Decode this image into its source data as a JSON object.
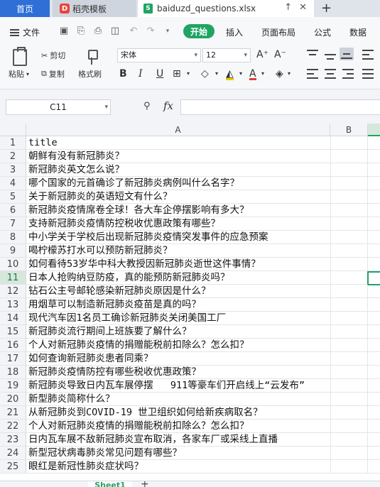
{
  "tabs": {
    "home": "首页",
    "template": "稻壳模板",
    "template_logo": "D",
    "file": "baiduzd_questions.xlsx",
    "file_logo": "S",
    "add": "+"
  },
  "menu": {
    "file": "文件",
    "start": "开始",
    "insert": "插入",
    "page_layout": "页面布局",
    "formula": "公式",
    "data": "数据"
  },
  "toolbar": {
    "paste": "粘贴",
    "cut": "剪切",
    "copy": "复制",
    "format_painter": "格式刷",
    "font_name": "宋体",
    "font_size": "12",
    "bold": "B",
    "italic": "I",
    "underline": "U",
    "grow": "A⁺",
    "shrink": "A⁻"
  },
  "formula_bar": {
    "name_box": "C11",
    "fx": "fx",
    "value": ""
  },
  "grid": {
    "columns": [
      "A",
      "B"
    ],
    "active_column": "C",
    "active_row": 11,
    "rows": [
      {
        "n": "1",
        "a": "title"
      },
      {
        "n": "2",
        "a": "朝鲜有没有新冠肺炎？"
      },
      {
        "n": "3",
        "a": "新冠肺炎英文怎么说？"
      },
      {
        "n": "4",
        "a": "哪个国家的元首确诊了新冠肺炎病例叫什么名字？"
      },
      {
        "n": "5",
        "a": "关于新冠肺炎的英语短文有什么？"
      },
      {
        "n": "6",
        "a": "新冠肺炎疫情席卷全球！各大车企停摆影响有多大？"
      },
      {
        "n": "7",
        "a": "支持新冠肺炎疫情防控税收优惠政策有哪些？"
      },
      {
        "n": "8",
        "a": "中小学关于学校后出现新冠肺炎疫情突发事件的应急预案"
      },
      {
        "n": "9",
        "a": "喝柠檬苏打水可以预防新冠肺炎？"
      },
      {
        "n": "10",
        "a": "如何看待53岁华中科大教授因新冠肺炎逝世这件事情？"
      },
      {
        "n": "11",
        "a": "日本人抢购纳豆防疫，真的能预防新冠肺炎吗？"
      },
      {
        "n": "12",
        "a": "钻石公主号邮轮感染新冠肺炎原因是什么？"
      },
      {
        "n": "13",
        "a": "用烟草可以制造新冠肺炎疫苗是真的吗？"
      },
      {
        "n": "14",
        "a": "现代汽车因1名员工确诊新冠肺炎关闭美国工厂"
      },
      {
        "n": "15",
        "a": "新冠肺炎流行期间上班族要了解什么？"
      },
      {
        "n": "16",
        "a": "个人对新冠肺炎疫情的捐赠能税前扣除么？怎么扣？"
      },
      {
        "n": "17",
        "a": "如何查询新冠肺炎患者同乘？"
      },
      {
        "n": "18",
        "a": "新冠肺炎疫情防控有哪些税收优惠政策？"
      },
      {
        "n": "19",
        "a": "新冠肺炎导致日内瓦车展停摆   911等豪车们开启线上“云发布”"
      },
      {
        "n": "20",
        "a": "新型肺炎简称什么？"
      },
      {
        "n": "21",
        "a": "从新冠肺炎到COVID-19 世卫组织如何给新疾病取名？"
      },
      {
        "n": "22",
        "a": "个人对新冠肺炎疫情的捐赠能税前扣除么？怎么扣？"
      },
      {
        "n": "23",
        "a": "日内瓦车展不敌新冠肺炎宣布取消，各家车厂或采线上直播"
      },
      {
        "n": "24",
        "a": "新型冠状病毒肺炎常见问题有哪些？"
      },
      {
        "n": "25",
        "a": "眼红是新冠性肺炎症状吗？"
      }
    ]
  },
  "sheets": {
    "active": "Sheet1",
    "add": "+"
  },
  "colors": {
    "accent": "#1fa463",
    "home_tab": "#2f6fd6"
  }
}
